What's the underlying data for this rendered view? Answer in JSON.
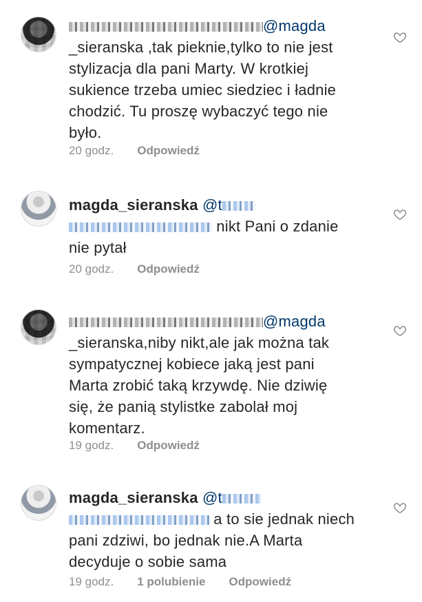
{
  "comments": [
    {
      "mention": "@magda",
      "lines": [
        "_sieranska ,tak pieknie,tylko to nie jest",
        "stylizacja dla pani Marty. W krotkiej",
        "sukience trzeba umiec siedziec i ładnie",
        "chodzić. Tu proszę wybaczyć tego nie",
        "było."
      ],
      "time": "20 godz.",
      "reply": "Odpowiedź"
    },
    {
      "username": "magda_sieranska",
      "mention": "@t",
      "line2_tail": " nikt Pani o zdanie",
      "lines": [
        "nie pytał"
      ],
      "time": "20 godz.",
      "reply": "Odpowiedź"
    },
    {
      "mention": "@magda",
      "lines": [
        "_sieranska,niby nikt,ale jak można tak",
        "sympatycznej kobiece jaką jest pani",
        "Marta zrobić taką krzywdę. Nie dziwię",
        "się, że panią stylistke zabolał moj",
        "komentarz."
      ],
      "time": "19 godz.",
      "reply": "Odpowiedź"
    },
    {
      "username": "magda_sieranska",
      "mention": "@t",
      "line2_tail": " a to sie jednak niech",
      "lines": [
        "pani zdziwi, bo jednak nie.A Marta",
        "decyduje o sobie sama"
      ],
      "time": "19 godz.",
      "likes": "1 polubienie",
      "reply": "Odpowiedź"
    }
  ],
  "icons": {
    "like": "heart-outline-icon"
  },
  "colors": {
    "text": "#262626",
    "meta": "#8e8e8e",
    "mention": "#00376b"
  }
}
